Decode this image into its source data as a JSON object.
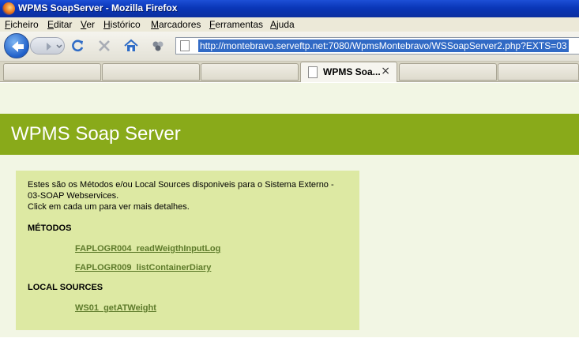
{
  "window": {
    "title": "WPMS SoapServer - Mozilla Firefox"
  },
  "menu": {
    "items": [
      {
        "first": "F",
        "rest": "icheiro"
      },
      {
        "first": "E",
        "rest": "ditar"
      },
      {
        "first": "V",
        "rest": "er"
      },
      {
        "first": "H",
        "rest": "istórico"
      },
      {
        "first": "M",
        "rest": "arcadores"
      },
      {
        "first": "F",
        "rest": "erramentas"
      },
      {
        "first": "A",
        "rest": "juda"
      }
    ]
  },
  "navbar": {
    "url": "http://montebravo.serveftp.net:7080/WpmsMontebravo/WSSoapServer2.php?EXTS=03"
  },
  "tabs": {
    "active_label": "WPMS Soa...",
    "close_glyph": "×"
  },
  "page": {
    "heading": "WPMS Soap Server",
    "description": {
      "line1": "Estes são os Métodos e/ou Local Sources disponiveis para o Sistema Externo -",
      "line2": "03-SOAP Webservices.",
      "line3": "Click em cada um para ver mais detalhes."
    },
    "methods_title": "MÉTODOS",
    "methods": [
      "FAPLOGR004_readWeigthInputLog",
      "FAPLOGR009_listContainerDiary"
    ],
    "local_sources_title": "LOCAL SOURCES",
    "local_sources": [
      "WS01_getATWeight"
    ]
  },
  "colors": {
    "banner": "#89aa1a",
    "page_bg": "#f2f6e4",
    "panel_bg": "#dde9a3",
    "link": "#5d7a2a"
  }
}
